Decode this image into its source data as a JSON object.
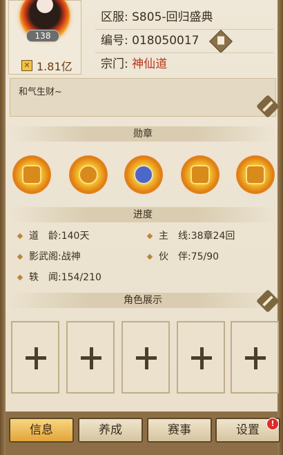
{
  "profile": {
    "level": "138",
    "power": "1.81亿",
    "server_label": "区服:",
    "server_value": "S805-回归盛典",
    "id_label": "编号:",
    "id_value": "018050017",
    "sect_label": "宗门:",
    "sect_value": "神仙道"
  },
  "signature": {
    "text": "和气生财~"
  },
  "medals_section": {
    "title": "勋章",
    "medals": [
      {
        "icon": "medal-fire-icon"
      },
      {
        "icon": "medal-crown-icon"
      },
      {
        "icon": "medal-lady-icon"
      },
      {
        "icon": "medal-warrior-icon"
      },
      {
        "icon": "medal-pagoda-icon"
      }
    ]
  },
  "progress_section": {
    "title": "进度",
    "items": [
      {
        "label": "道　龄:",
        "value": "140天"
      },
      {
        "label": "主　线:",
        "value": "38章24回"
      },
      {
        "label": "影武阁:",
        "value": "战神"
      },
      {
        "label": "伙　伴:",
        "value": "75/90"
      },
      {
        "label": "轶　闻:",
        "value": "154/210"
      }
    ]
  },
  "roles_section": {
    "title": "角色展示",
    "slot_count": 5
  },
  "tabs": [
    {
      "label": "信息",
      "active": true
    },
    {
      "label": "养成",
      "active": false
    },
    {
      "label": "赛事",
      "active": false
    },
    {
      "label": "设置",
      "active": false
    }
  ],
  "alert_badge": "!",
  "colors": {
    "accent_red": "#b6361d",
    "tab_active": "#e2a53b",
    "frame_brown": "#8c6f46"
  }
}
